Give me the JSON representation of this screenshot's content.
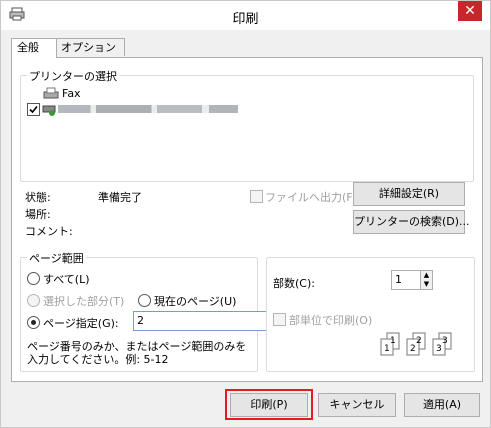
{
  "window": {
    "title": "印刷",
    "close_label": "✕"
  },
  "tabs": [
    {
      "label": "全般",
      "active": true
    },
    {
      "label": "オプション",
      "active": false
    }
  ],
  "printer_select": {
    "group_label": "プリンターの選択",
    "printers": [
      {
        "name": "Fax",
        "icon": "fax-icon",
        "selected": false
      },
      {
        "name": "",
        "icon": "printer-icon",
        "selected": true,
        "note_blurred": true
      }
    ],
    "status_label": "状態:",
    "status_value": "準備完了",
    "location_label": "場所:",
    "comment_label": "コメント:",
    "print_to_file_label": "ファイルへ出力(F)",
    "print_to_file_checked": false,
    "details_button": "詳細設定(R)",
    "find_printer_button": "プリンターの検索(D)..."
  },
  "page_range": {
    "group_label": "ページ範囲",
    "all_label": "すべて(L)",
    "selection_label": "選択した部分(T)",
    "current_page_label": "現在のページ(U)",
    "pages_label": "ページ指定(G):",
    "pages_value": "2",
    "hint": "ページ番号のみか、またはページ範囲のみを入力してください。例: 5-12",
    "selected": "pages"
  },
  "copies": {
    "count_label": "部数(C):",
    "count_value": "1",
    "collate_label": "部単位で印刷(O)",
    "collate_checked": false,
    "collate_icon_digits": [
      "1",
      "1",
      "2",
      "2",
      "3",
      "3"
    ]
  },
  "footer": {
    "print_button": "印刷(P)",
    "cancel_button": "キャンセル",
    "apply_button": "適用(A)"
  },
  "colors": {
    "highlight": "#e31b23",
    "close_button": "#c7272a"
  }
}
